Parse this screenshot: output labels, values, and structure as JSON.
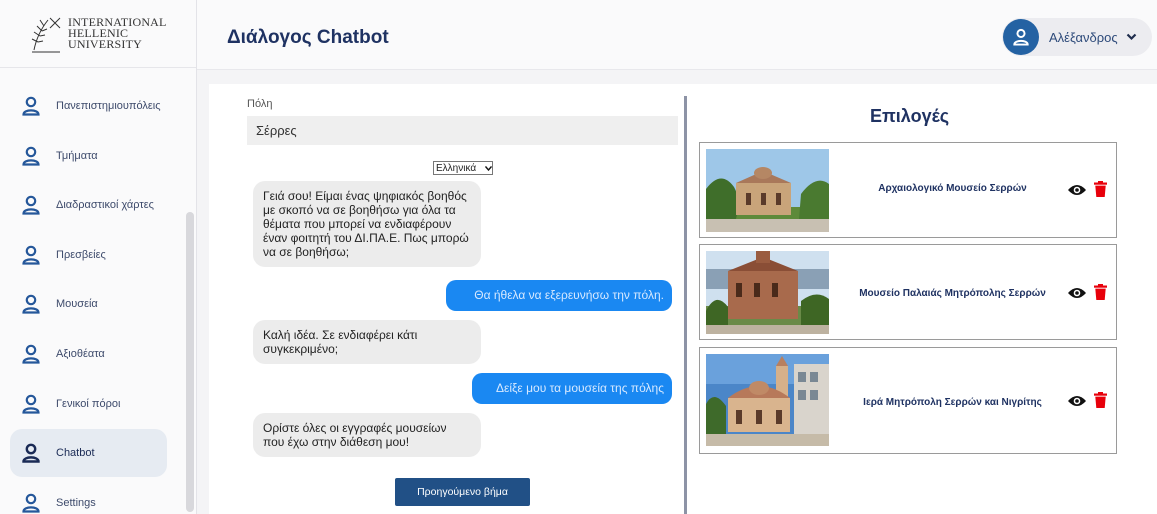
{
  "brand": {
    "line1": "INTERNATIONAL",
    "line2": "HELLENIC",
    "line3": "UNIVERSITY"
  },
  "sidebar": {
    "items": [
      {
        "label": "Πανεπιστημιουπόλεις"
      },
      {
        "label": "Τμήματα"
      },
      {
        "label": "Διαδραστικοί χάρτες"
      },
      {
        "label": "Πρεσβείες"
      },
      {
        "label": "Μουσεία"
      },
      {
        "label": "Αξιοθέατα"
      },
      {
        "label": "Γενικοί πόροι"
      },
      {
        "label": "Chatbot"
      },
      {
        "label": "Settings"
      }
    ],
    "active": "Chatbot"
  },
  "header": {
    "title": "Διάλογος Chatbot",
    "user_name": "Αλέξανδρος"
  },
  "chat": {
    "city_label": "Πόλη",
    "city_value": "Σέρρες",
    "language": "Ελληνικά",
    "messages": [
      {
        "from": "bot",
        "text": "Γειά σου! Είμαι ένας ψηφιακός βοηθός με σκοπό να σε βοηθήσω για όλα τα θέματα που μπορεί να ενδιαφέρουν έναν φοιτητή του ΔΙ.ΠΑ.Ε. Πως μπορώ να σε βοηθήσω;"
      },
      {
        "from": "user",
        "text": "Θα ήθελα να εξερευνήσω την πόλη."
      },
      {
        "from": "bot",
        "text": "Καλή ιδέα. Σε ενδιαφέρει κάτι συγκεκριμένο;"
      },
      {
        "from": "user",
        "text": "Δείξε μου τα μουσεία της πόλης"
      },
      {
        "from": "bot",
        "text": "Ορίστε όλες οι εγγραφές μουσείων που έχω στην διάθεση μου!"
      }
    ],
    "prev_button": "Προηγούμενο βήμα"
  },
  "options": {
    "title": "Επιλογές",
    "cards": [
      {
        "title": "Αρχαιολογικό Μουσείο Σερρών",
        "image": "byzantine-stone-building-photo"
      },
      {
        "title": "Μουσείο Παλαιάς Μητρόπολης Σερρών",
        "image": "old-metropolis-church-photo"
      },
      {
        "title": "Ιερά Μητρόπολη Σερρών και Νιγρίτης",
        "image": "cathedral-with-bell-tower-photo"
      }
    ]
  },
  "colors": {
    "brand_navy": "#1f3262",
    "user_bubble": "#1a88f2",
    "bot_bubble": "#ececec",
    "primary_button": "#215086",
    "delete_red": "#e8000b"
  }
}
